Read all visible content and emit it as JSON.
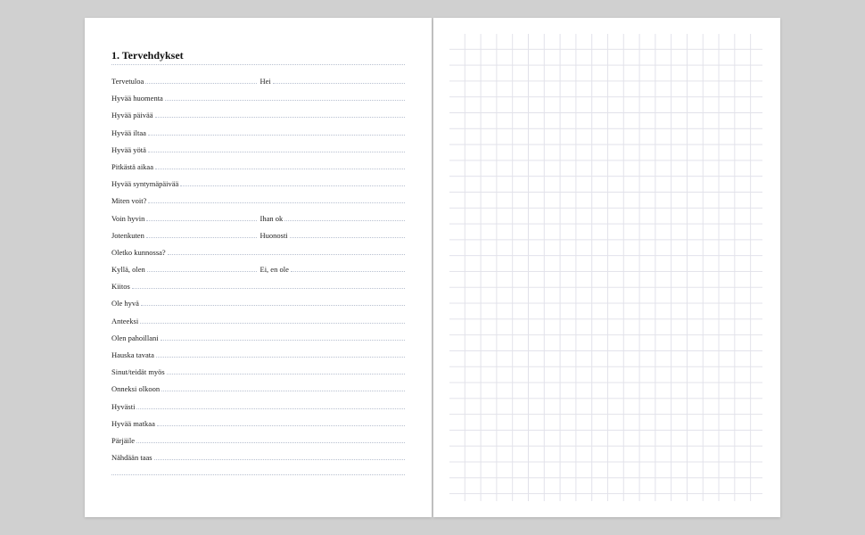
{
  "heading": "1. Tervehdykset",
  "rows": [
    {
      "type": "double",
      "left": "Tervetuloa",
      "right": "Hei"
    },
    {
      "type": "single",
      "left": "Hyvää huomenta"
    },
    {
      "type": "single",
      "left": "Hyvää päivää"
    },
    {
      "type": "single",
      "left": "Hyvää iltaa"
    },
    {
      "type": "single",
      "left": "Hyvää yötä"
    },
    {
      "type": "single",
      "left": "Pitkästä aikaa"
    },
    {
      "type": "single",
      "left": "Hyvää syntymäpäivää"
    },
    {
      "type": "single",
      "left": "Miten voit?"
    },
    {
      "type": "double",
      "left": "Voin hyvin",
      "right": "Ihan ok"
    },
    {
      "type": "double",
      "left": "Jotenkuten",
      "right": "Huonosti"
    },
    {
      "type": "single",
      "left": "Oletko kunnossa?"
    },
    {
      "type": "double",
      "left": "Kyllä, olen",
      "right": "Ei, en ole"
    },
    {
      "type": "single",
      "left": "Kiitos"
    },
    {
      "type": "single",
      "left": "Ole hyvä"
    },
    {
      "type": "single",
      "left": "Anteeksi"
    },
    {
      "type": "single",
      "left": "Olen pahoillani"
    },
    {
      "type": "single",
      "left": "Hauska tavata"
    },
    {
      "type": "single",
      "left": "Sinut/teidät myös"
    },
    {
      "type": "single",
      "left": "Onneksi olkoon"
    },
    {
      "type": "single",
      "left": "Hyvästi"
    },
    {
      "type": "single",
      "left": "Hyvää matkaa"
    },
    {
      "type": "single",
      "left": "Pärjäile"
    },
    {
      "type": "single",
      "left": "Nähdään taas"
    }
  ]
}
